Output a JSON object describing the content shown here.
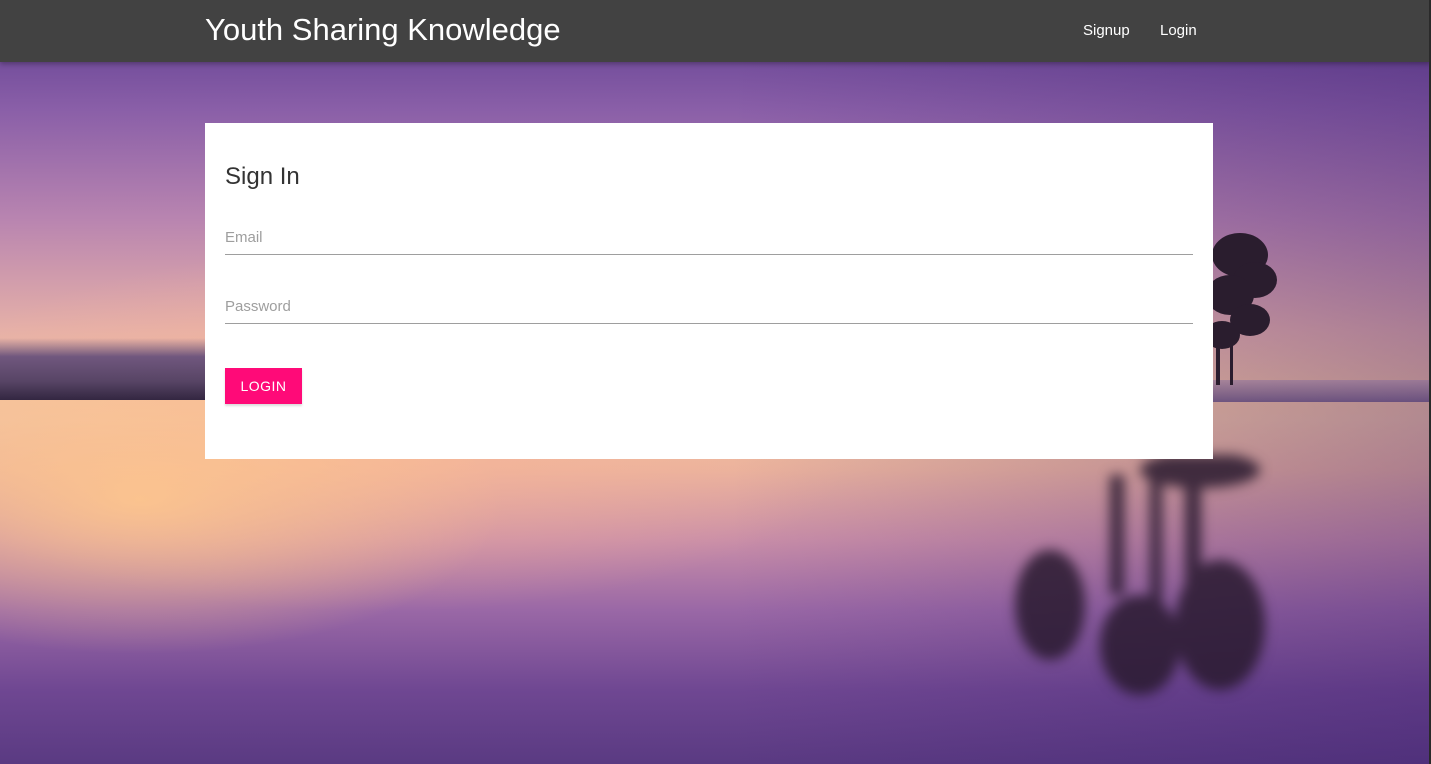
{
  "navbar": {
    "brand": "Youth Sharing Knowledge",
    "links": [
      {
        "label": "Signup"
      },
      {
        "label": "Login"
      }
    ]
  },
  "signin": {
    "title": "Sign In",
    "email": {
      "placeholder": "Email",
      "value": ""
    },
    "password": {
      "placeholder": "Password",
      "value": ""
    },
    "submit_label": "LOGIN"
  },
  "colors": {
    "navbar_bg": "#424242",
    "accent": "#ff0a78",
    "card_bg": "#ffffff"
  },
  "background_image": "sunset-lake-with-tree"
}
